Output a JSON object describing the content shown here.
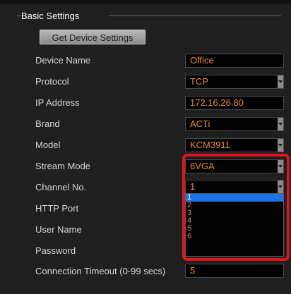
{
  "group": {
    "title": "Basic Settings"
  },
  "buttons": {
    "get_device_settings": "Get Device Settings"
  },
  "fields": {
    "device_name": {
      "label": "Device Name",
      "value": "Office"
    },
    "protocol": {
      "label": "Protocol",
      "value": "TCP"
    },
    "ip_address": {
      "label": "IP Address",
      "value": "172.16.26.80"
    },
    "brand": {
      "label": "Brand",
      "value": "ACTi"
    },
    "model": {
      "label": "Model",
      "value": "KCM3911"
    },
    "stream_mode": {
      "label": "Stream Mode",
      "value": "6VGA"
    },
    "channel_no": {
      "label": "Channel No.",
      "value": "1",
      "options": [
        "1",
        "2",
        "3",
        "4",
        "5",
        "6"
      ]
    },
    "http_port": {
      "label": "HTTP Port"
    },
    "user_name": {
      "label": "User Name"
    },
    "password": {
      "label": "Password"
    },
    "connection_timeout": {
      "label": "Connection Timeout (0-99 secs)",
      "value": "5"
    }
  },
  "colors": {
    "value_text": "#f08a32",
    "highlight": "#e2141c",
    "selected_option": "#1a73e8"
  }
}
